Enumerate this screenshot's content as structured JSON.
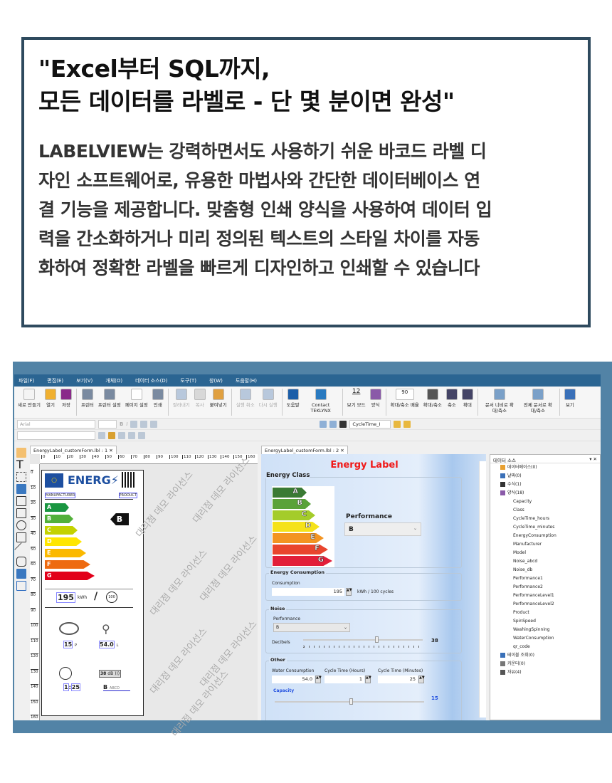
{
  "hero": {
    "title_lines": [
      "\"Excel부터 SQL까지,",
      "모든 데이터를 라벨로 - 단 몇 분이면 완성\""
    ],
    "body_lines": [
      "LABELVIEW는 강력하면서도 사용하기 쉬운 바코드 라벨 디",
      "자인 소프트웨어로, 유용한 마법사와 간단한 데이터베이스 연",
      "결 기능을 제공합니다. 맞춤형 인쇄 양식을 사용하여 데이터 입",
      "력을 간소화하거나 미리 정의된 텍스트의 스타일 차이를 자동",
      "화하여 정확한 라벨을 빠르게 디자인하고 인쇄할 수 있습니다"
    ]
  },
  "menu": [
    "파일(F)",
    "편집(E)",
    "보기(V)",
    "개체(O)",
    "데이터 소스(D)",
    "도구(T)",
    "창(W)",
    "도움말(H)"
  ],
  "ribbon": [
    {
      "label": "새로 만들기",
      "color": "#f4f4f4"
    },
    {
      "label": "열기",
      "color": "#f0b030"
    },
    {
      "label": "저장",
      "color": "#8a2b8a"
    },
    {
      "sep": true
    },
    {
      "label": "프린터",
      "color": "#7a8aa0"
    },
    {
      "label": "프린터 설정",
      "color": "#7a8aa0"
    },
    {
      "label": "페이지 설정",
      "color": "#ffffff"
    },
    {
      "label": "인쇄",
      "color": "#7a8aa0"
    },
    {
      "sep": true
    },
    {
      "label": "잘라내기",
      "color": "#b8c8dc",
      "disabled": true
    },
    {
      "label": "복사",
      "color": "#d8d8d8",
      "disabled": true
    },
    {
      "label": "붙여넣기",
      "color": "#e0a040"
    },
    {
      "sep": true
    },
    {
      "label": "실행 취소",
      "color": "#b8c8dc",
      "disabled": true
    },
    {
      "label": "다시 실행",
      "color": "#b8c8dc",
      "disabled": true
    },
    {
      "sep": true
    },
    {
      "label": "도움말",
      "color": "#1c5ea8"
    },
    {
      "label": "Contact TEKLYNX",
      "color": "#2a7ac0"
    },
    {
      "sep": true
    },
    {
      "label": "보기 모드",
      "color": "#f6f6f6"
    },
    {
      "label": "양식",
      "color": "#8a5aa8"
    },
    {
      "sep": true
    },
    {
      "label": "확대/축소 배율",
      "color": "#ffffff"
    },
    {
      "label": "확대/축소",
      "color": "#555555"
    },
    {
      "label": "축소",
      "color": "#444466"
    },
    {
      "label": "확대",
      "color": "#444466"
    },
    {
      "sep": true
    },
    {
      "label": "문서 너비로 확대/축소",
      "color": "#7aa0c8"
    },
    {
      "label": "전체 문서로 확대/축소",
      "color": "#7aa0c8"
    },
    {
      "sep": true
    },
    {
      "label": "보기",
      "color": "#3a70b8"
    }
  ],
  "view_mode_value": "12",
  "zoom_value": "90",
  "toolbar": {
    "font": "Arial",
    "form_select": "CycleTime_I"
  },
  "designer": {
    "tab": "EnergyLabel_customForm.lbl : 1",
    "ruler_h": [
      "0",
      "10",
      "20",
      "30",
      "40",
      "50",
      "60",
      "70",
      "80",
      "90",
      "100",
      "110",
      "120",
      "130",
      "140",
      "150",
      "160"
    ],
    "ruler_v": [
      "0",
      "10",
      "20",
      "30",
      "40",
      "50",
      "60",
      "70",
      "80",
      "90",
      "100",
      "110",
      "120",
      "130",
      "140",
      "150",
      "160"
    ],
    "watermark": "대리점 데모 라이선스"
  },
  "label": {
    "brand": "ENERG",
    "manufacturer": "MANUFACTURER",
    "product": "PRODUCT",
    "class": "B",
    "kwh": "195",
    "kwh_unit": "kWh",
    "cycles": "100",
    "capacity": "15",
    "capacity_unit": "P",
    "water": "54.0",
    "water_unit": "L",
    "time_h": "1",
    "time_m": "25",
    "db": "38",
    "db_unit": "dB",
    "noise_class": "B",
    "noise_scale": "ABCD"
  },
  "classes": [
    {
      "l": "A",
      "c": "#1a9641"
    },
    {
      "l": "B",
      "c": "#52b03a"
    },
    {
      "l": "C",
      "c": "#c4d200"
    },
    {
      "l": "D",
      "c": "#ffe600"
    },
    {
      "l": "E",
      "c": "#fbb900"
    },
    {
      "l": "F",
      "c": "#ee6a10"
    },
    {
      "l": "G",
      "c": "#e2001a"
    }
  ],
  "form_classes": [
    {
      "l": "A",
      "c": "#3a7a34"
    },
    {
      "l": "B",
      "c": "#5aa23a"
    },
    {
      "l": "C",
      "c": "#a4cc2a"
    },
    {
      "l": "D",
      "c": "#f5e21a"
    },
    {
      "l": "E",
      "c": "#f39422"
    },
    {
      "l": "F",
      "c": "#e9452e"
    },
    {
      "l": "G",
      "c": "#e21f3a"
    }
  ],
  "form": {
    "tab": "EnergyLabel_customForm.lbl : 2",
    "title": "Energy Label",
    "energy_class": "Energy Class",
    "performance_label": "Performance",
    "performance": "B",
    "ec_legend": "Energy Consumption",
    "consumption_label": "Consumption",
    "consumption": "195",
    "consumption_unit": "kWh / 100 cycles",
    "noise_legend": "Noise",
    "noise_perf_label": "Performance",
    "noise_perf": "B",
    "decibels_label": "Decibels",
    "decibels": "38",
    "decibels_fraction": 0.6,
    "other_legend": "Other",
    "water_label": "Water Consumption",
    "water": "54.0",
    "hours_label": "Cycle Time (Hours)",
    "hours": "1",
    "minutes_label": "Cycle Time (Minutes)",
    "minutes": "25",
    "capacity_label": "Capacity",
    "capacity": "15",
    "capacity_fraction": 0.5
  },
  "datasource": {
    "title": "데이터 소스",
    "items": [
      {
        "t": "데이터베이스(0)",
        "lvl": 1
      },
      {
        "t": "날짜(0)",
        "lvl": 1
      },
      {
        "t": "수식(1)",
        "lvl": 1
      },
      {
        "t": "양식(18)",
        "lvl": 1
      },
      {
        "t": "Capacity",
        "lvl": 2
      },
      {
        "t": "Class",
        "lvl": 2
      },
      {
        "t": "CycleTime_hours",
        "lvl": 2
      },
      {
        "t": "CycleTime_minutes",
        "lvl": 2
      },
      {
        "t": "EnergyConsumption",
        "lvl": 2
      },
      {
        "t": "Manufacturer",
        "lvl": 2
      },
      {
        "t": "Model",
        "lvl": 2
      },
      {
        "t": "Noise_abcd",
        "lvl": 2
      },
      {
        "t": "Noise_db",
        "lvl": 2
      },
      {
        "t": "Performance1",
        "lvl": 2
      },
      {
        "t": "Performance2",
        "lvl": 2
      },
      {
        "t": "PerformanceLevel1",
        "lvl": 2
      },
      {
        "t": "PerformanceLevel2",
        "lvl": 2
      },
      {
        "t": "Product",
        "lvl": 2
      },
      {
        "t": "SpinSpeed",
        "lvl": 2
      },
      {
        "t": "WashingSpinning",
        "lvl": 2
      },
      {
        "t": "WaterConsumption",
        "lvl": 2
      },
      {
        "t": "qr_code",
        "lvl": 2
      },
      {
        "t": "테이블 조회(0)",
        "lvl": 1
      },
      {
        "t": "카운터(0)",
        "lvl": 1
      },
      {
        "t": "자유(4)",
        "lvl": 1
      }
    ]
  }
}
